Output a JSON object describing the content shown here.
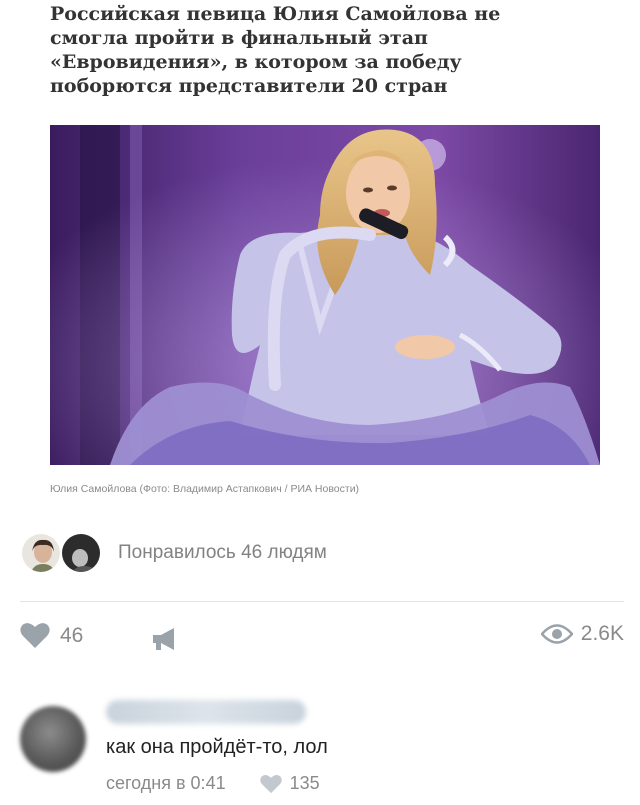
{
  "article": {
    "headline": "Российская певица Юлия Самойлова не смогла пройти в финальный этап «Евровидения», в котором за победу поборются представители 20 стран",
    "photo_caption": "Юлия Самойлова (Фото: Владимир Астапкович / РИА Новости)"
  },
  "post": {
    "liked_by_text": "Понравилось 46 людям",
    "like_count": "46",
    "views_count": "2.6K"
  },
  "comment": {
    "text": "как она пройдёт-то, лол",
    "time": "сегодня в 0:41",
    "like_count": "135"
  },
  "colors": {
    "muted_text": "#8a8a8a",
    "icon_gray": "#9aa2aa",
    "stage_purple": "#7a4aa8",
    "dress_lavender": "#c5c3e8"
  },
  "icons": [
    "heart-icon",
    "megaphone-icon",
    "eye-icon"
  ]
}
